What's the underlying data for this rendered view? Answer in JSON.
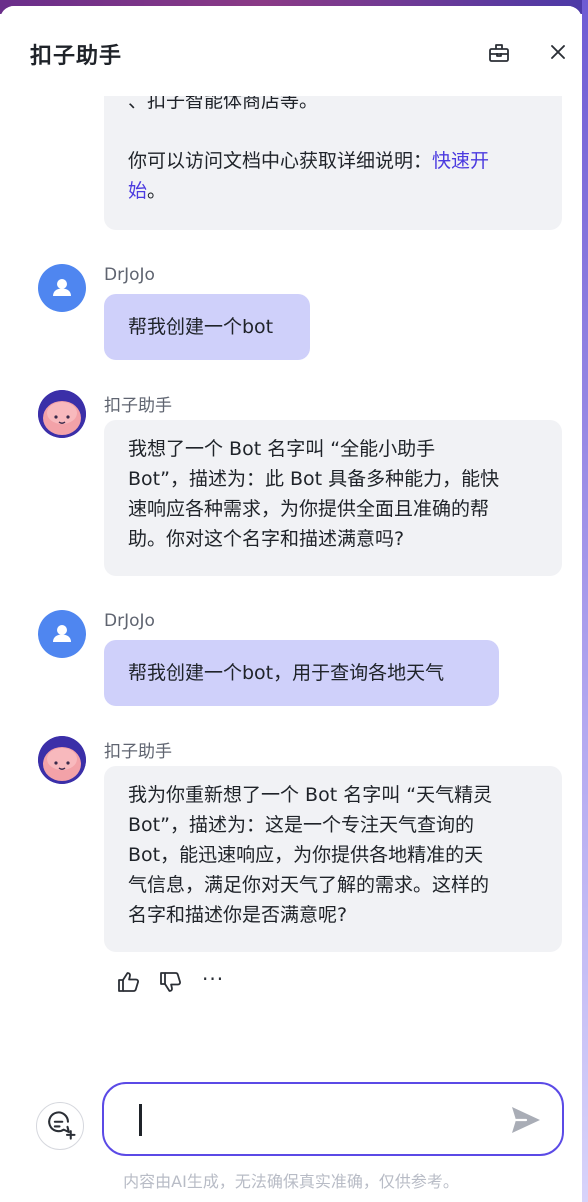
{
  "header": {
    "title": "扣子助手"
  },
  "messages": [
    {
      "lines": [
        "、扣子智能体商店等。",
        "",
        "你可以访问文档中心获取详细说明："
      ],
      "link_text_1": "快速开",
      "link_text_2": "始",
      "tail": "。"
    },
    {
      "sender": "DrJoJo",
      "text": "帮我创建一个bot"
    },
    {
      "sender": "扣子助手",
      "lines": [
        "我想了一个 Bot 名字叫 “全能小助手",
        "Bot”，描述为：此 Bot 具备多种能力，能快",
        "速响应各种需求，为你提供全面且准确的帮",
        "助。你对这个名字和描述满意吗?"
      ]
    },
    {
      "sender": "DrJoJo",
      "text": "帮我创建一个bot，用于查询各地天气"
    },
    {
      "sender": "扣子助手",
      "lines": [
        "我为你重新想了一个 Bot 名字叫 “天气精灵",
        "Bot”，描述为：这是一个专注天气查询的",
        "Bot，能迅速响应，为你提供各地精准的天",
        "气信息，满足你对天气了解的需求。这样的",
        "名字和描述你是否满意呢?"
      ]
    }
  ],
  "actions": {
    "more": "···"
  },
  "composer": {
    "placeholder": "",
    "value": ""
  },
  "footer": {
    "disclaimer": "内容由AI生成，无法确保真实准确，仅供参考。"
  },
  "colors": {
    "accent": "#5b4ae6",
    "link": "#4b3ae0",
    "user_bubble": "#cfd0fa",
    "bot_bubble": "#f1f2f5",
    "user_avatar": "#4f86f0"
  }
}
